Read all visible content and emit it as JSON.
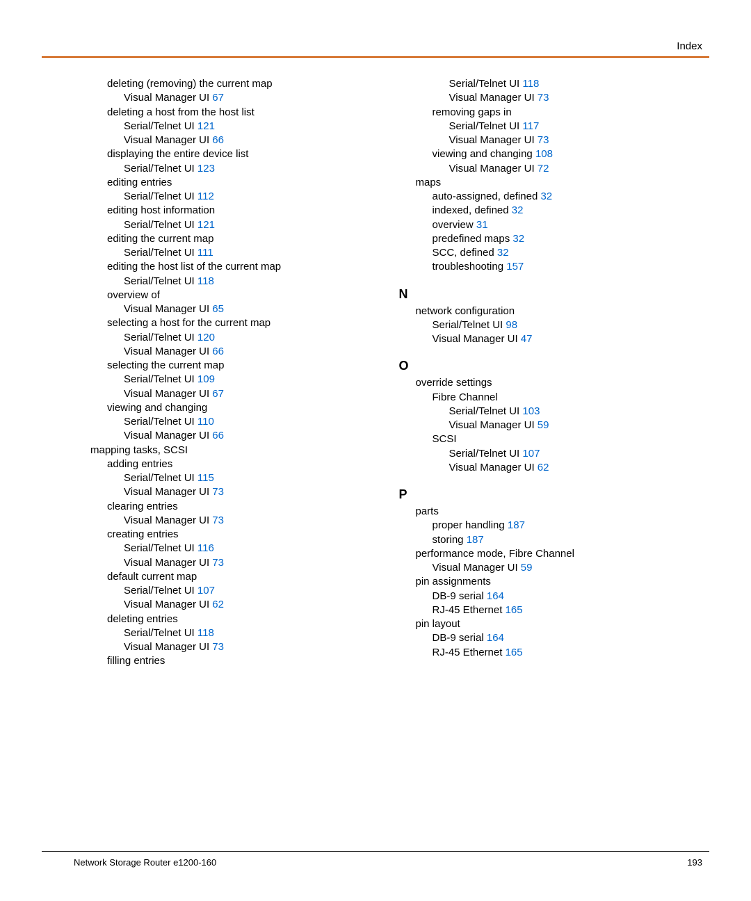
{
  "header": {
    "label": "Index"
  },
  "footer": {
    "left": "Network Storage Router e1200-160",
    "right": "193"
  },
  "left_column": [
    {
      "indent": 2,
      "text": "deleting (removing) the current map"
    },
    {
      "indent": 3,
      "text": "Visual Manager UI ",
      "page": "67"
    },
    {
      "indent": 2,
      "text": "deleting a host from the host list"
    },
    {
      "indent": 3,
      "text": "Serial/Telnet UI ",
      "page": "121"
    },
    {
      "indent": 3,
      "text": "Visual Manager UI ",
      "page": "66"
    },
    {
      "indent": 2,
      "text": "displaying the entire device list"
    },
    {
      "indent": 3,
      "text": "Serial/Telnet UI ",
      "page": "123"
    },
    {
      "indent": 2,
      "text": "editing entries"
    },
    {
      "indent": 3,
      "text": "Serial/Telnet UI ",
      "page": "112"
    },
    {
      "indent": 2,
      "text": "editing host information"
    },
    {
      "indent": 3,
      "text": "Serial/Telnet UI ",
      "page": "121"
    },
    {
      "indent": 2,
      "text": "editing the current map"
    },
    {
      "indent": 3,
      "text": "Serial/Telnet UI ",
      "page": "111"
    },
    {
      "indent": 2,
      "text": "editing the host list of the current map"
    },
    {
      "indent": 3,
      "text": "Serial/Telnet UI ",
      "page": "118"
    },
    {
      "indent": 2,
      "text": "overview of"
    },
    {
      "indent": 3,
      "text": "Visual Manager UI ",
      "page": "65"
    },
    {
      "indent": 2,
      "text": "selecting a host for the current map"
    },
    {
      "indent": 3,
      "text": "Serial/Telnet UI ",
      "page": "120"
    },
    {
      "indent": 3,
      "text": "Visual Manager UI ",
      "page": "66"
    },
    {
      "indent": 2,
      "text": "selecting the current map"
    },
    {
      "indent": 3,
      "text": "Serial/Telnet UI ",
      "page": "109"
    },
    {
      "indent": 3,
      "text": "Visual Manager UI ",
      "page": "67"
    },
    {
      "indent": 2,
      "text": "viewing and changing"
    },
    {
      "indent": 3,
      "text": "Serial/Telnet UI ",
      "page": "110"
    },
    {
      "indent": 3,
      "text": "Visual Manager UI ",
      "page": "66"
    },
    {
      "indent": 1,
      "text": "mapping tasks, SCSI"
    },
    {
      "indent": 2,
      "text": "adding entries"
    },
    {
      "indent": 3,
      "text": "Serial/Telnet UI ",
      "page": "115"
    },
    {
      "indent": 3,
      "text": "Visual Manager UI ",
      "page": "73"
    },
    {
      "indent": 2,
      "text": "clearing entries"
    },
    {
      "indent": 3,
      "text": "Visual Manager UI ",
      "page": "73"
    },
    {
      "indent": 2,
      "text": "creating entries"
    },
    {
      "indent": 3,
      "text": "Serial/Telnet UI ",
      "page": "116"
    },
    {
      "indent": 3,
      "text": "Visual Manager UI ",
      "page": "73"
    },
    {
      "indent": 2,
      "text": "default current map"
    },
    {
      "indent": 3,
      "text": "Serial/Telnet UI ",
      "page": "107"
    },
    {
      "indent": 3,
      "text": "Visual Manager UI ",
      "page": "62"
    },
    {
      "indent": 2,
      "text": "deleting entries"
    },
    {
      "indent": 3,
      "text": "Serial/Telnet UI ",
      "page": "118"
    },
    {
      "indent": 3,
      "text": "Visual Manager UI ",
      "page": "73"
    },
    {
      "indent": 2,
      "text": "filling entries"
    }
  ],
  "right_column": [
    {
      "indent": 3,
      "text": "Serial/Telnet UI ",
      "page": "118"
    },
    {
      "indent": 3,
      "text": "Visual Manager UI ",
      "page": "73"
    },
    {
      "indent": 2,
      "text": "removing gaps in"
    },
    {
      "indent": 3,
      "text": "Serial/Telnet UI ",
      "page": "117"
    },
    {
      "indent": 3,
      "text": "Visual Manager UI ",
      "page": "73"
    },
    {
      "indent": 2,
      "text": "viewing and changing ",
      "page": "108"
    },
    {
      "indent": 3,
      "text": "Visual Manager UI ",
      "page": "72"
    },
    {
      "indent": 1,
      "text": "maps"
    },
    {
      "indent": 2,
      "text": "auto-assigned, defined ",
      "page": "32"
    },
    {
      "indent": 2,
      "text": "indexed, defined ",
      "page": "32"
    },
    {
      "indent": 2,
      "text": "overview ",
      "page": "31"
    },
    {
      "indent": 2,
      "text": "predefined maps ",
      "page": "32"
    },
    {
      "indent": 2,
      "text": "SCC, defined ",
      "page": "32"
    },
    {
      "indent": 2,
      "text": "troubleshooting ",
      "page": "157"
    },
    {
      "section": "N"
    },
    {
      "indent": 1,
      "text": "network configuration"
    },
    {
      "indent": 2,
      "text": "Serial/Telnet UI ",
      "page": "98"
    },
    {
      "indent": 2,
      "text": "Visual Manager UI ",
      "page": "47"
    },
    {
      "section": "O"
    },
    {
      "indent": 1,
      "text": "override settings"
    },
    {
      "indent": 2,
      "text": "Fibre Channel"
    },
    {
      "indent": 3,
      "text": "Serial/Telnet UI ",
      "page": "103"
    },
    {
      "indent": 3,
      "text": "Visual Manager UI ",
      "page": "59"
    },
    {
      "indent": 2,
      "text": "SCSI"
    },
    {
      "indent": 3,
      "text": "Serial/Telnet UI ",
      "page": "107"
    },
    {
      "indent": 3,
      "text": "Visual Manager UI ",
      "page": "62"
    },
    {
      "section": "P"
    },
    {
      "indent": 1,
      "text": "parts"
    },
    {
      "indent": 2,
      "text": "proper handling ",
      "page": "187"
    },
    {
      "indent": 2,
      "text": "storing ",
      "page": "187"
    },
    {
      "indent": 1,
      "text": "performance mode, Fibre Channel"
    },
    {
      "indent": 2,
      "text": "Visual Manager UI ",
      "page": "59"
    },
    {
      "indent": 1,
      "text": "pin assignments"
    },
    {
      "indent": 2,
      "text": "DB-9 serial ",
      "page": "164"
    },
    {
      "indent": 2,
      "text": "RJ-45 Ethernet ",
      "page": "165"
    },
    {
      "indent": 1,
      "text": "pin layout"
    },
    {
      "indent": 2,
      "text": "DB-9 serial ",
      "page": "164"
    },
    {
      "indent": 2,
      "text": "RJ-45 Ethernet ",
      "page": "165"
    }
  ]
}
